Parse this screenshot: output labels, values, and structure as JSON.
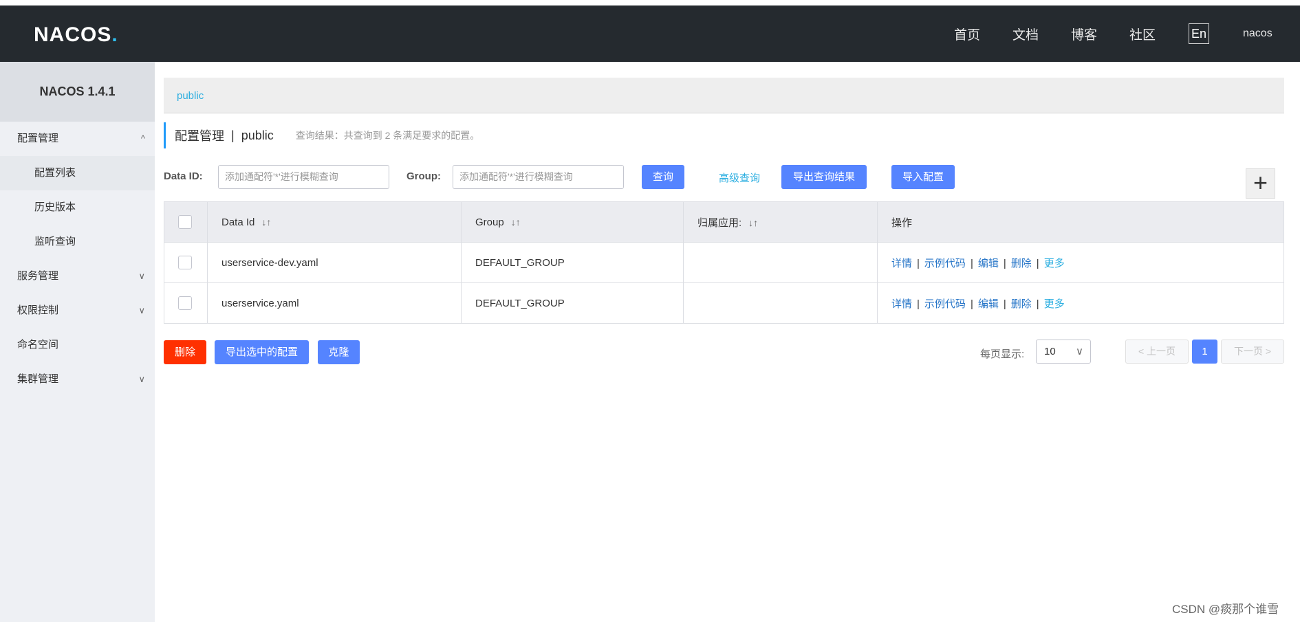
{
  "header": {
    "logo": "NACOS",
    "logo_dot": ".",
    "nav": [
      "首页",
      "文档",
      "博客",
      "社区"
    ],
    "lang_button": "En",
    "username": "nacos"
  },
  "sidebar": {
    "title": "NACOS 1.4.1",
    "items": [
      {
        "label": "配置管理",
        "chevron": "^"
      },
      {
        "label": "配置列表"
      },
      {
        "label": "历史版本"
      },
      {
        "label": "监听查询"
      },
      {
        "label": "服务管理",
        "chevron": "∨"
      },
      {
        "label": "权限控制",
        "chevron": "∨"
      },
      {
        "label": "命名空间"
      },
      {
        "label": "集群管理",
        "chevron": "∨"
      }
    ]
  },
  "namespace_bar": {
    "current": "public"
  },
  "page": {
    "title": "配置管理",
    "separator": "|",
    "namespace": "public",
    "result_text": "查询结果：共查询到 2 条满足要求的配置。"
  },
  "search": {
    "data_id_label": "Data ID:",
    "data_id_placeholder": "添加通配符'*'进行模糊查询",
    "group_label": "Group:",
    "group_placeholder": "添加通配符'*'进行模糊查询",
    "query_button": "查询",
    "advanced_link": "高级查询",
    "export_results_button": "导出查询结果",
    "import_button": "导入配置",
    "add_button": "+"
  },
  "table": {
    "headers": [
      "Data Id",
      "Group",
      "归属应用:",
      "操作"
    ],
    "sort_icon": "↓↑",
    "rows": [
      {
        "data_id": "userservice-dev.yaml",
        "group": "DEFAULT_GROUP",
        "app": ""
      },
      {
        "data_id": "userservice.yaml",
        "group": "DEFAULT_GROUP",
        "app": ""
      }
    ],
    "actions": {
      "detail": "详情",
      "sample": "示例代码",
      "edit": "编辑",
      "delete": "删除",
      "more": "更多",
      "sep": "|"
    }
  },
  "bulk": {
    "delete_button": "删除",
    "export_selected_button": "导出选中的配置",
    "clone_button": "克隆"
  },
  "pagination": {
    "page_size_label": "每页显示:",
    "page_size": "10",
    "prev": "< 上一页",
    "current_page": "1",
    "next": "下一页 >"
  },
  "watermark": "CSDN @痰那个谁雪"
}
